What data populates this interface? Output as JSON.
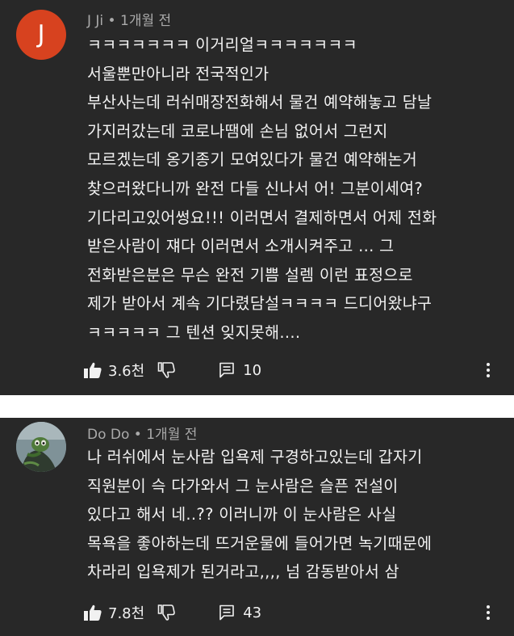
{
  "comments": [
    {
      "avatar_letter": "J",
      "avatar_color": "#d7421f",
      "author": "J Ji",
      "time": "1개월 전",
      "lines": [
        "ㅋㅋㅋㅋㅋㅋㅋ 이거리얼ㅋㅋㅋㅋㅋㅋㅋ",
        "서울뿐만아니라 전국적인가",
        "부산사는데 러쉬매장전화해서 물건 예약해놓고 담날",
        "가지러갔는데 코로나땜에 손님 없어서 그런지",
        "모르겠는데 옹기종기 모여있다가 물건 예약해논거",
        "찾으러왔다니까 완전 다들 신나서 어! 그분이세여?",
        "기다리고있어썽요!!! 이러면서 결제하면서 어제 전화",
        "받은사람이 쟤다 이러면서 소개시켜주고 ... 그",
        "전화받은분은 무슨 완전 기쁨 설렘 이런 표정으로",
        "제가 받아서 계속 기다렸담설ㅋㅋㅋㅋ 드디어왔냐구",
        "ㅋㅋㅋㅋㅋ 그 텐션 잊지못해...."
      ],
      "likes": "3.6천",
      "replies": "10"
    },
    {
      "author": "Do Do",
      "time": "1개월 전",
      "lines": [
        "나 러쉬에서 눈사람 입욕제 구경하고있는데 갑자기",
        "직원분이 슥 다가와서 그 눈사람은 슬픈 전설이",
        "있다고 해서 네..?? 이러니까 이 눈사람은 사실",
        "목욕을 좋아하는데 뜨거운물에 들어가면 녹기때문에",
        "차라리 입욕제가 된거라고,,,, 넘 감동받아서 삼"
      ],
      "likes": "7.8천",
      "replies": "43"
    }
  ],
  "separator": " • ",
  "colors": {
    "card_background": "#282828",
    "page_background": "#ffffff",
    "primary_text": "#f1f1f1",
    "secondary_text": "#aaaaaa"
  },
  "icons": {
    "like": "thumb-up-icon",
    "dislike": "thumb-down-icon",
    "reply": "reply-icon",
    "menu": "more-vert-icon"
  }
}
